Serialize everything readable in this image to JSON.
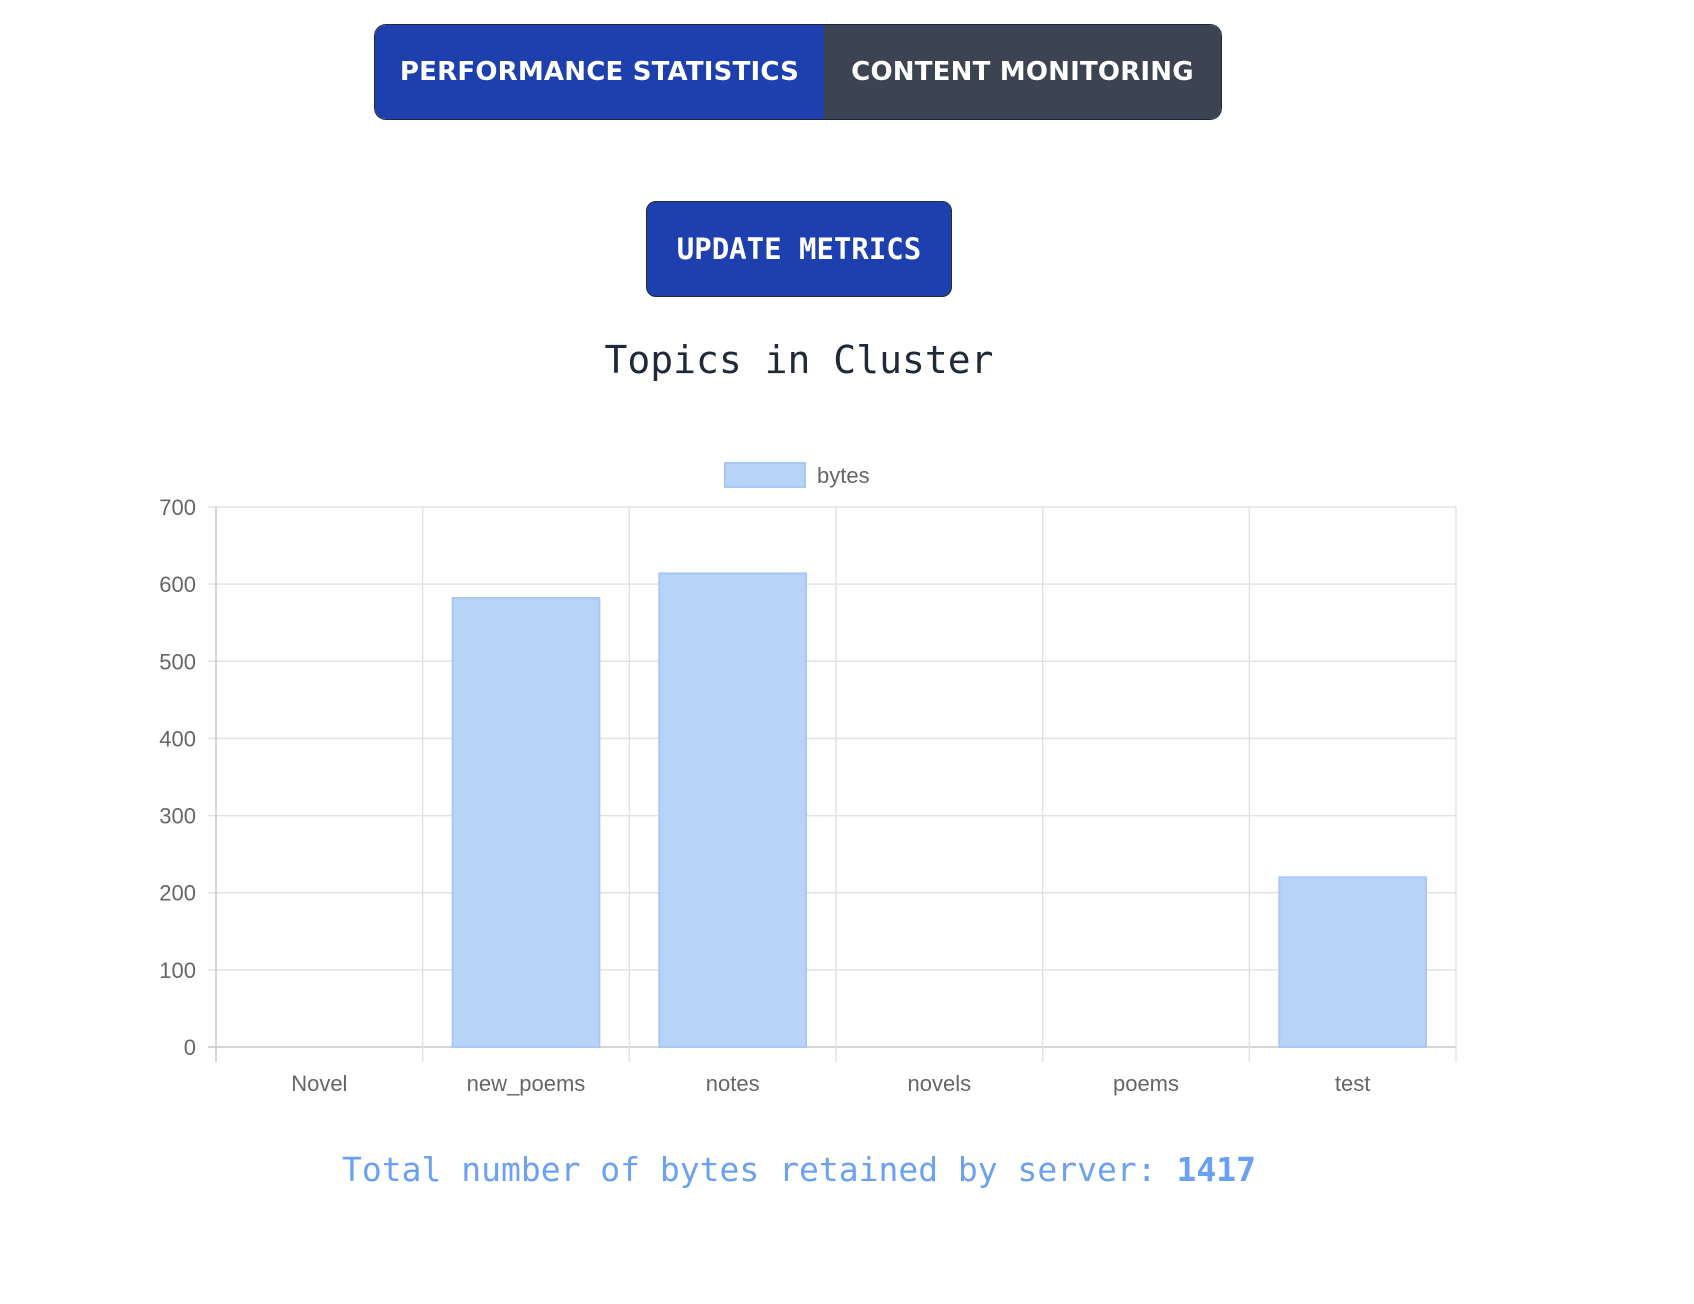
{
  "tabs": [
    {
      "label": "PERFORMANCE STATISTICS",
      "active": true
    },
    {
      "label": "CONTENT MONITORING",
      "active": false
    }
  ],
  "update_button": {
    "label": "UPDATE METRICS"
  },
  "heading": "Topics in Cluster",
  "chart_data": {
    "type": "bar",
    "categories": [
      "Novel",
      "new_poems",
      "notes",
      "novels",
      "poems",
      "test"
    ],
    "series": [
      {
        "name": "bytes",
        "values": [
          0,
          582,
          614,
          0,
          0,
          220
        ],
        "color": "#b7d3f7",
        "border": "#a9c8f2"
      }
    ],
    "ylim": [
      0,
      700
    ],
    "yticks": [
      0,
      100,
      200,
      300,
      400,
      500,
      600,
      700
    ],
    "grid": true,
    "legend": "top"
  },
  "total": {
    "label": "Total number of bytes retained by server:",
    "value": "1417"
  },
  "colors": {
    "accent": "#1e40af",
    "inactive_tab": "#3d4451",
    "bar": "#b7d3f7",
    "total_text": "#6ca0f0"
  }
}
